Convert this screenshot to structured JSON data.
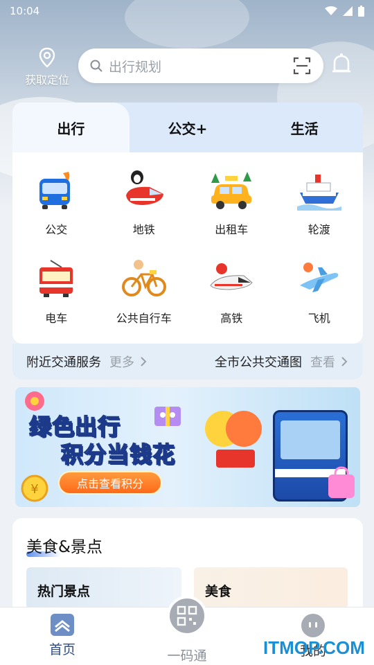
{
  "status": {
    "time": "10:04"
  },
  "header": {
    "location_label": "获取定位",
    "search_placeholder": "出行规划"
  },
  "tabs": [
    "出行",
    "公交+",
    "生活"
  ],
  "services": [
    {
      "label": "公交",
      "icon": "bus-icon"
    },
    {
      "label": "地铁",
      "icon": "subway-icon"
    },
    {
      "label": "出租车",
      "icon": "taxi-icon"
    },
    {
      "label": "轮渡",
      "icon": "ferry-icon"
    },
    {
      "label": "电车",
      "icon": "tram-icon"
    },
    {
      "label": "公共自行车",
      "icon": "bicycle-icon"
    },
    {
      "label": "高铁",
      "icon": "high-speed-rail-icon"
    },
    {
      "label": "飞机",
      "icon": "airplane-icon"
    }
  ],
  "nearby": {
    "left_label": "附近交通服务",
    "left_more": "更多",
    "right_label": "全市公共交通图",
    "right_more": "查看"
  },
  "banner": {
    "line1": "绿色出行",
    "line2": "积分当钱花",
    "button": "点击查看积分"
  },
  "section": {
    "title": "美食&景点",
    "cards": [
      "热门景点",
      "美食"
    ]
  },
  "bottom_nav": {
    "home": "首页",
    "center": "一码通",
    "me": "我的"
  },
  "watermark": "ITMOP.COM",
  "colors": {
    "accent": "#2c4c8c",
    "tab_bg": "#dbe9fa",
    "link_gray": "#9aa0a8"
  }
}
